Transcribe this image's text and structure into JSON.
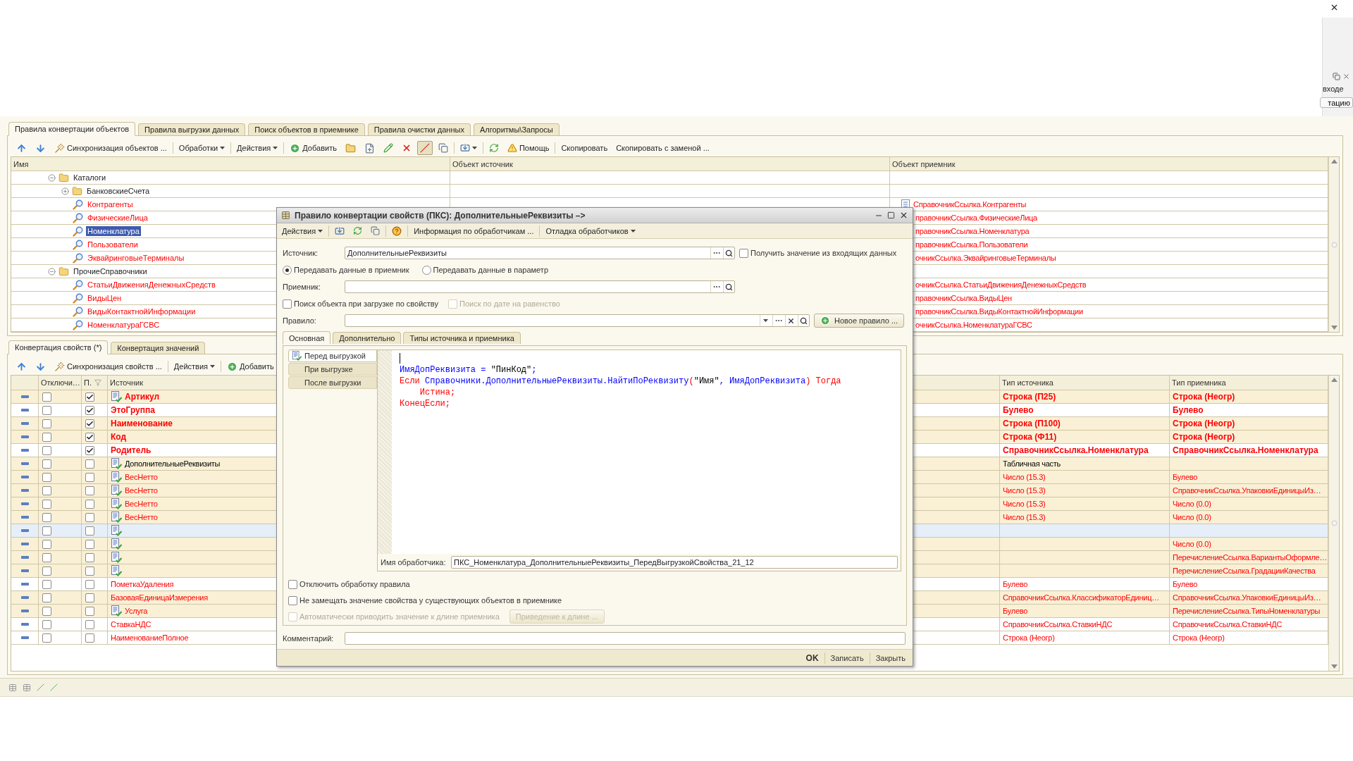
{
  "side_panel": {
    "label": "входе",
    "button": "тацию"
  },
  "upper": {
    "tabs": [
      {
        "label": "Правила конвертации объектов",
        "selected": true
      },
      {
        "label": "Правила выгрузки данных",
        "selected": false
      },
      {
        "label": "Поиск объектов в приемнике",
        "selected": false
      },
      {
        "label": "Правила очистки данных",
        "selected": false
      },
      {
        "label": "Алгоритмы\\Запросы",
        "selected": false
      }
    ],
    "toolbar": {
      "sync": "Синхронизация объектов ...",
      "menus": [
        "Обработки",
        "Действия"
      ],
      "add": "Добавить",
      "toggle_pressed": true,
      "help": "Помощь",
      "copy": "Скопировать",
      "copy_replace": "Скопировать с заменой ..."
    },
    "table": {
      "columns": [
        "Имя",
        "Объект источник",
        "Объект приемник"
      ],
      "tree": [
        {
          "kind": "folder",
          "label": "Каталоги",
          "expanded": true,
          "selected": false,
          "children": [
            {
              "kind": "folder",
              "label": "БанковскиеСчета",
              "expanded": false,
              "selected": false
            },
            {
              "kind": "rule",
              "label": "Контрагенты",
              "target": "СправочникСсылка.Контрагенты",
              "target_icon": true,
              "selected": false
            },
            {
              "kind": "rule",
              "label": "ФизическиеЛица",
              "target": "правочникСсылка.ФизическиеЛица",
              "selected": false
            },
            {
              "kind": "rule",
              "label": "Номенклатура",
              "target": "правочникСсылка.Номенклатура",
              "selected": true
            },
            {
              "kind": "rule",
              "label": "Пользователи",
              "target": "правочникСсылка.Пользователи",
              "selected": false
            },
            {
              "kind": "rule",
              "label": "ЭквайринговыеТерминалы",
              "target": "очникСсылка.ЭквайринговыеТерминалы",
              "selected": false
            }
          ]
        },
        {
          "kind": "folder",
          "label": "ПрочиеСправочники",
          "expanded": true,
          "selected": false,
          "children": [
            {
              "kind": "rule",
              "label": "СтатьиДвиженияДенежныхСредств",
              "target": "очникСсылка.СтатьиДвиженияДенежныхСредств",
              "selected": false
            },
            {
              "kind": "rule",
              "label": "ВидыЦен",
              "target": "правочникСсылка.ВидыЦен",
              "selected": false
            },
            {
              "kind": "rule",
              "label": "ВидыКонтактнойИнформации",
              "target": "правочникСсылка.ВидыКонтактнойИнформации",
              "selected": false
            },
            {
              "kind": "rule",
              "label": "НоменклатураГСВС",
              "target": "очникСсылка.НоменклатураГСВС",
              "selected": false
            }
          ]
        }
      ]
    }
  },
  "lower": {
    "tabs": [
      {
        "label": "Конвертация свойств (*)",
        "selected": true
      },
      {
        "label": "Конвертация значений",
        "selected": false
      }
    ],
    "toolbar": {
      "sync": "Синхронизация свойств ...",
      "menus": [
        "Действия"
      ],
      "add": "Добавить"
    },
    "table": {
      "columns": [
        "Отключи…",
        "П.",
        "Источник",
        "Тип источника",
        "Тип приемника"
      ],
      "rows": [
        {
          "off_checked": false,
          "p_checked": true,
          "handler": true,
          "source": "Артикул",
          "bold": true,
          "color": "#ff0000",
          "source_type": "Строка (П25)",
          "target_type": "Строка (Неогр)",
          "shaded": true,
          "selected": false
        },
        {
          "off_checked": false,
          "p_checked": true,
          "handler": false,
          "source": "ЭтоГруппа",
          "bold": true,
          "color": "#ff0000",
          "source_type": "Булево",
          "target_type": "Булево",
          "shaded": false,
          "selected": false
        },
        {
          "off_checked": false,
          "p_checked": true,
          "handler": false,
          "source": "Наименование",
          "bold": true,
          "color": "#ff0000",
          "source_type": "Строка (П100)",
          "target_type": "Строка (Неогр)",
          "shaded": true,
          "selected": false
        },
        {
          "off_checked": false,
          "p_checked": true,
          "handler": false,
          "source": "Код",
          "bold": true,
          "color": "#ff0000",
          "source_type": "Строка (Ф11)",
          "target_type": "Строка (Неогр)",
          "shaded": true,
          "selected": false
        },
        {
          "off_checked": false,
          "p_checked": true,
          "handler": false,
          "source": "Родитель",
          "bold": true,
          "color": "#ff0000",
          "source_type": "СправочникСсылка.Номенклатура",
          "target_type": "СправочникСсылка.Номенклатура",
          "shaded": false,
          "selected": false
        },
        {
          "off_checked": false,
          "p_checked": false,
          "handler": true,
          "source": "ДополнительныеРеквизиты",
          "bold": false,
          "color": "#000000",
          "source_type": "Табличная часть",
          "shaded": true,
          "selected": false
        },
        {
          "off_checked": false,
          "p_checked": false,
          "handler": true,
          "source": "ВесНетто",
          "bold": false,
          "color": "#ff0000",
          "source_type": "Число (15.3)",
          "target_type": "Булево",
          "shaded": true,
          "selected": false
        },
        {
          "off_checked": false,
          "p_checked": false,
          "handler": true,
          "source": "ВесНетто",
          "bold": false,
          "color": "#ff0000",
          "source_type": "Число (15.3)",
          "target_type": "СправочникСсылка.УпаковкиЕдиницыИз…",
          "shaded": true,
          "selected": false
        },
        {
          "off_checked": false,
          "p_checked": false,
          "handler": true,
          "source": "ВесНетто",
          "bold": false,
          "color": "#ff0000",
          "source_type": "Число (15.3)",
          "target_type": "Число (0.0)",
          "shaded": true,
          "selected": false
        },
        {
          "off_checked": false,
          "p_checked": false,
          "handler": true,
          "source": "ВесНетто",
          "bold": false,
          "color": "#ff0000",
          "source_type": "Число (15.3)",
          "target_type": "Число (0.0)",
          "shaded": true,
          "selected": false
        },
        {
          "off_checked": false,
          "p_checked": false,
          "handler": true,
          "selected": true
        },
        {
          "off_checked": false,
          "p_checked": false,
          "handler": true,
          "bold": false,
          "color": "#ff0000",
          "target_type": "Число (0.0)",
          "shaded": true,
          "selected": false
        },
        {
          "off_checked": false,
          "p_checked": false,
          "handler": true,
          "bold": false,
          "color": "#ff0000",
          "target_type": "ПеречислениеСсылка.ВариантыОформле…",
          "shaded": true,
          "selected": false
        },
        {
          "off_checked": false,
          "p_checked": false,
          "handler": true,
          "bold": false,
          "color": "#ff0000",
          "target_type": "ПеречислениеСсылка.ГрадацииКачества",
          "shaded": true,
          "selected": false
        },
        {
          "off_checked": false,
          "p_checked": false,
          "handler": false,
          "source": "ПометкаУдаления",
          "bold": false,
          "color": "#ff0000",
          "source_type": "Булево",
          "target_type": "Булево",
          "shaded": false,
          "selected": false
        },
        {
          "off_checked": false,
          "p_checked": false,
          "handler": false,
          "source": "БазоваяЕдиницаИзмерения",
          "bold": false,
          "color": "#ff0000",
          "source_type": "СправочникСсылка.КлассификаторЕдиниц…",
          "target_type": "СправочникСсылка.УпаковкиЕдиницыИз…",
          "shaded": true,
          "selected": false
        },
        {
          "off_checked": false,
          "p_checked": false,
          "handler": true,
          "source": "Услуга",
          "bold": false,
          "color": "#ff0000",
          "source_type": "Булево",
          "target_type": "ПеречислениеСсылка.ТипыНоменклатуры",
          "shaded": true,
          "selected": false
        },
        {
          "off_checked": false,
          "p_checked": false,
          "handler": false,
          "source": "СтавкаНДС",
          "bold": false,
          "color": "#ff0000",
          "source_type": "СправочникСсылка.СтавкиНДС",
          "target_type": "СправочникСсылка.СтавкиНДС",
          "shaded": false,
          "selected": false
        },
        {
          "off_checked": false,
          "p_checked": false,
          "handler": false,
          "source": "НаименованиеПолное",
          "bold": false,
          "color": "#ff0000",
          "source_type": "Строка (Неогр)",
          "target_type": "Строка (Неогр)",
          "shaded": false,
          "selected": false
        }
      ]
    }
  },
  "dialog": {
    "title": "Правило конвертации свойств (ПКС): ДополнительныеРеквизиты –>",
    "toolbar": {
      "actions": "Действия",
      "info": "Информация по обработчикам ...",
      "debug": "Отладка обработчиков"
    },
    "source": {
      "label": "Источник:",
      "value": "ДополнительныеРеквизиты"
    },
    "get_incoming": {
      "label": "Получить значение из входящих данных",
      "checked": false
    },
    "transfer": [
      {
        "label": "Передавать данные в приемник",
        "selected": true
      },
      {
        "label": "Передавать данные в параметр",
        "selected": false
      }
    ],
    "target": {
      "label": "Приемник:"
    },
    "search_options": [
      {
        "label": "Поиск объекта при загрузке по свойству",
        "checked": false,
        "disabled": false
      },
      {
        "label": "Поиск по дате на равенство",
        "checked": false,
        "disabled": true
      }
    ],
    "rule": {
      "label": "Правило:"
    },
    "new_rule": "Новое правило ...",
    "tabs": [
      {
        "label": "Основная",
        "selected": true
      },
      {
        "label": "Дополнительно",
        "selected": false
      },
      {
        "label": "Типы источника и приемника",
        "selected": false
      }
    ],
    "handlers": [
      {
        "label": "Перед выгрузкой",
        "selected": true
      },
      {
        "label": "При выгрузке",
        "selected": false
      },
      {
        "label": "После выгрузки",
        "selected": false
      }
    ],
    "code": [
      [
        {
          "text": "ИмяДопРеквизита = ",
          "kind": "ident"
        },
        {
          "text": "\"ПинКод\"",
          "kind": "string"
        },
        {
          "text": ";",
          "kind": "ident"
        }
      ],
      [
        {
          "text": "Если ",
          "kind": "keyword"
        },
        {
          "text": "Справочники.ДополнительныеРеквизиты.НайтиПоРеквизиту",
          "kind": "ident"
        },
        {
          "text": "(",
          "kind": "keyword"
        },
        {
          "text": "\"Имя\"",
          "kind": "string"
        },
        {
          "text": ", ИмяДопРеквизита",
          "kind": "ident"
        },
        {
          "text": ") Тогда",
          "kind": "keyword"
        }
      ],
      [
        {
          "text": "    Истина;",
          "kind": "keyword"
        }
      ],
      [
        {
          "text": "КонецЕсли;",
          "kind": "keyword"
        }
      ]
    ],
    "handler_name": {
      "label": "Имя обработчика:",
      "value": "ПКС_Номенклатура_ДополнительныеРеквизиты_ПередВыгрузкойСвойства_21_12"
    },
    "options": [
      {
        "label": "Отключить обработку правила",
        "checked": false,
        "disabled": false
      },
      {
        "label": "Не замещать значение свойства у существующих объектов в приемнике",
        "checked": false,
        "disabled": false
      },
      {
        "label": "Автоматически приводить значение к длине приемника",
        "checked": false,
        "disabled": true
      }
    ],
    "length_button": {
      "label": "Приведение к длине ...",
      "disabled": true
    },
    "comment": {
      "label": "Комментарий:"
    },
    "buttons": [
      {
        "label": "OK",
        "default": true
      },
      {
        "label": "Записать",
        "default": false
      },
      {
        "label": "Закрыть",
        "default": false
      }
    ]
  }
}
